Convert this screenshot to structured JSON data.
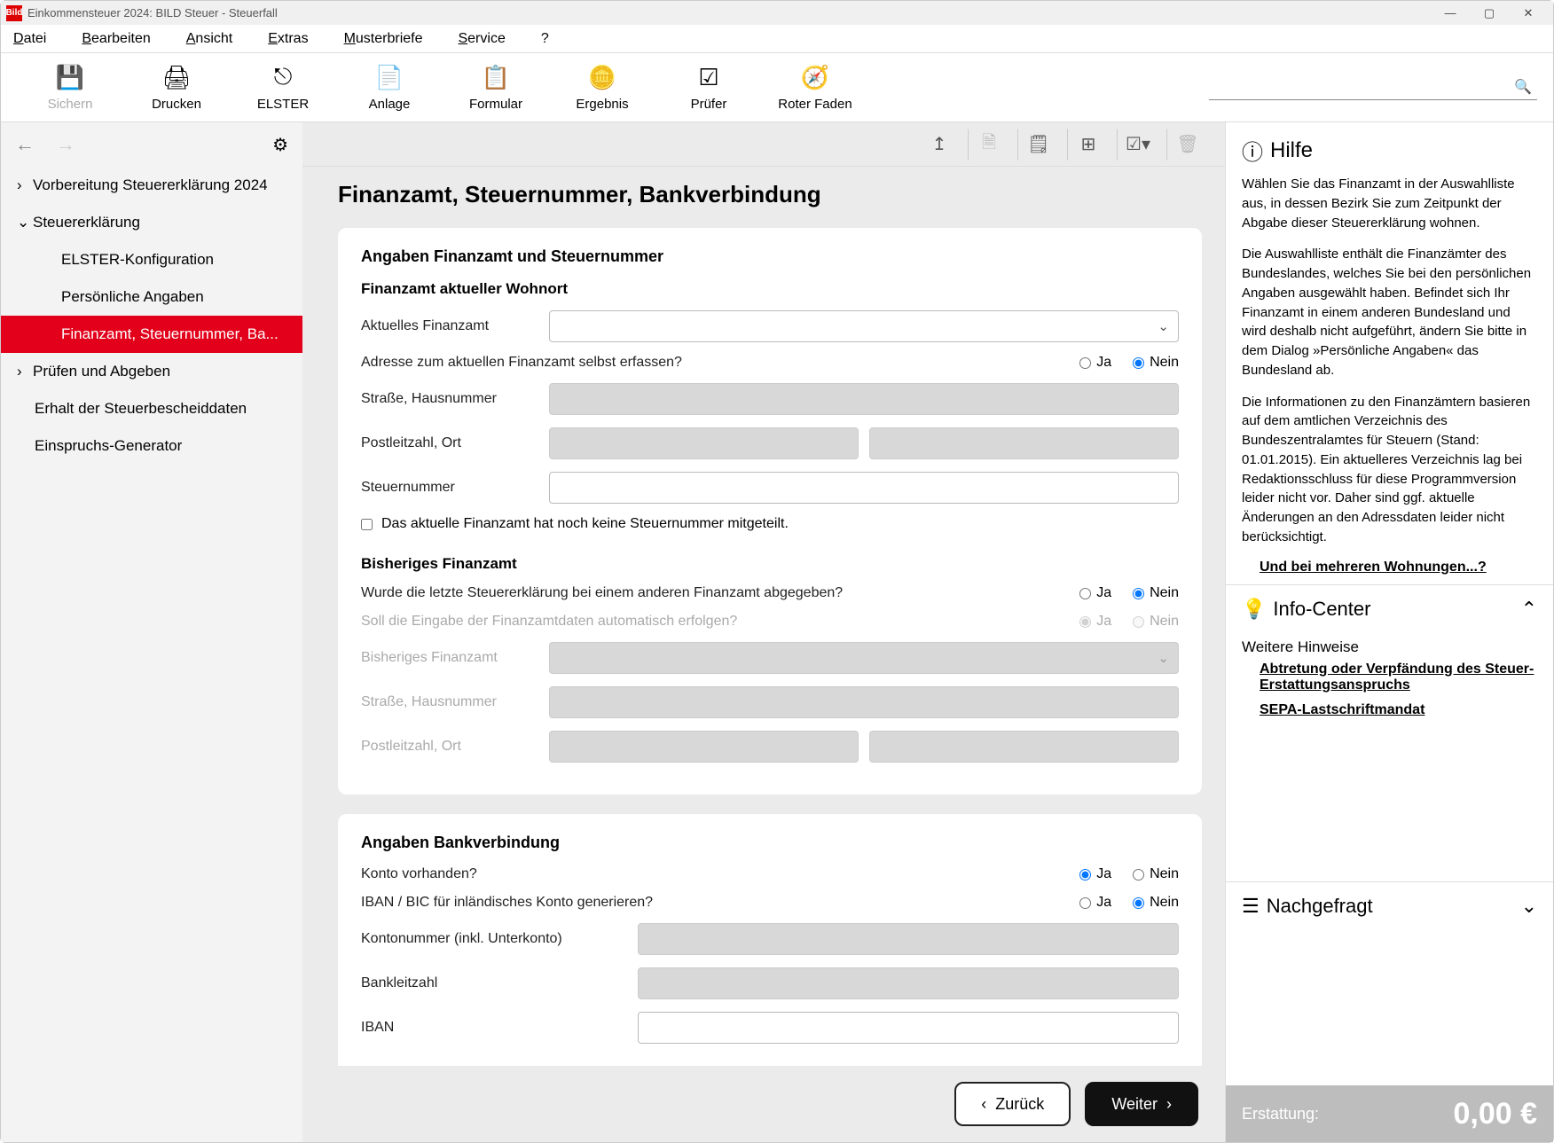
{
  "window": {
    "title": "Einkommensteuer 2024: BILD Steuer - Steuerfall"
  },
  "menu": {
    "datei": "Datei",
    "bearbeiten": "Bearbeiten",
    "ansicht": "Ansicht",
    "extras": "Extras",
    "musterbriefe": "Musterbriefe",
    "service": "Service",
    "help": "?"
  },
  "toolbar": {
    "sichern": "Sichern",
    "drucken": "Drucken",
    "elster": "ELSTER",
    "anlage": "Anlage",
    "formular": "Formular",
    "ergebnis": "Ergebnis",
    "pruefer": "Prüfer",
    "roter": "Roter Faden"
  },
  "tree": {
    "vorbereitung": "Vorbereitung Steuererklärung 2024",
    "steuererklaerung": "Steuererklärung",
    "elster": "ELSTER-Konfiguration",
    "persoenlich": "Persönliche Angaben",
    "finanzamt": "Finanzamt, Steuernummer, Ba...",
    "pruefen": "Prüfen und Abgeben",
    "erhalt": "Erhalt der Steuerbescheiddaten",
    "einspruch": "Einspruchs-Generator"
  },
  "page": {
    "title": "Finanzamt, Steuernummer, Bankverbindung",
    "section1": "Angaben Finanzamt und Steuernummer",
    "sub1": "Finanzamt aktueller Wohnort",
    "aktuelles_finanzamt": "Aktuelles Finanzamt",
    "adresse_selbst": "Adresse zum aktuellen Finanzamt selbst erfassen?",
    "strasse": "Straße, Hausnummer",
    "plz": "Postleitzahl, Ort",
    "steuernummer": "Steuernummer",
    "no_stnr": "Das aktuelle Finanzamt hat noch keine Steuernummer mitgeteilt.",
    "sub2": "Bisheriges Finanzamt",
    "letzte_anderes": "Wurde die letzte Steuererklärung bei einem anderen Finanzamt abgegeben?",
    "auto": "Soll die Eingabe der Finanzamtdaten automatisch erfolgen?",
    "bisheriges": "Bisheriges Finanzamt",
    "section2": "Angaben Bankverbindung",
    "konto": "Konto vorhanden?",
    "ibanbic": "IBAN / BIC für inländisches Konto generieren?",
    "kontonr": "Kontonummer (inkl. Unterkonto)",
    "blz": "Bankleitzahl",
    "iban": "IBAN",
    "ja": "Ja",
    "nein": "Nein",
    "back": "Zurück",
    "next": "Weiter"
  },
  "help": {
    "title": "Hilfe",
    "p1": "Wählen Sie das Finanzamt in der Auswahlliste aus, in dessen Bezirk Sie zum Zeitpunkt der Abgabe dieser Steuererklärung wohnen.",
    "p2": "Die Auswahlliste enthält die Finanzämter des Bundeslandes, welches Sie bei den persönlichen Angaben ausgewählt haben. Befindet sich Ihr Finanzamt in einem anderen Bundesland und wird deshalb nicht aufgeführt, ändern Sie bitte in dem Dialog »Persönliche Angaben« das Bundesland ab.",
    "p3": "Die Informationen zu den Finanzämtern basieren auf dem amtlichen Verzeichnis des Bundeszentralamtes für Steuern (Stand: 01.01.2015). Ein aktuelleres Verzeichnis lag bei Redaktionsschluss für diese Programmversion leider nicht vor. Daher sind ggf. aktuelle Änderungen an den Adressdaten leider nicht berücksichtigt.",
    "link1": "Und bei mehreren Wohnungen...?",
    "info": "Info-Center",
    "hinweise": "Weitere Hinweise",
    "link2": "Abtretung oder Verpfändung des Steuer-Erstattungsanspruchs",
    "link3": "SEPA-Lastschriftmandat",
    "nachgefragt": "Nachgefragt"
  },
  "refund": {
    "label": "Erstattung:",
    "value": "0,00 €"
  }
}
